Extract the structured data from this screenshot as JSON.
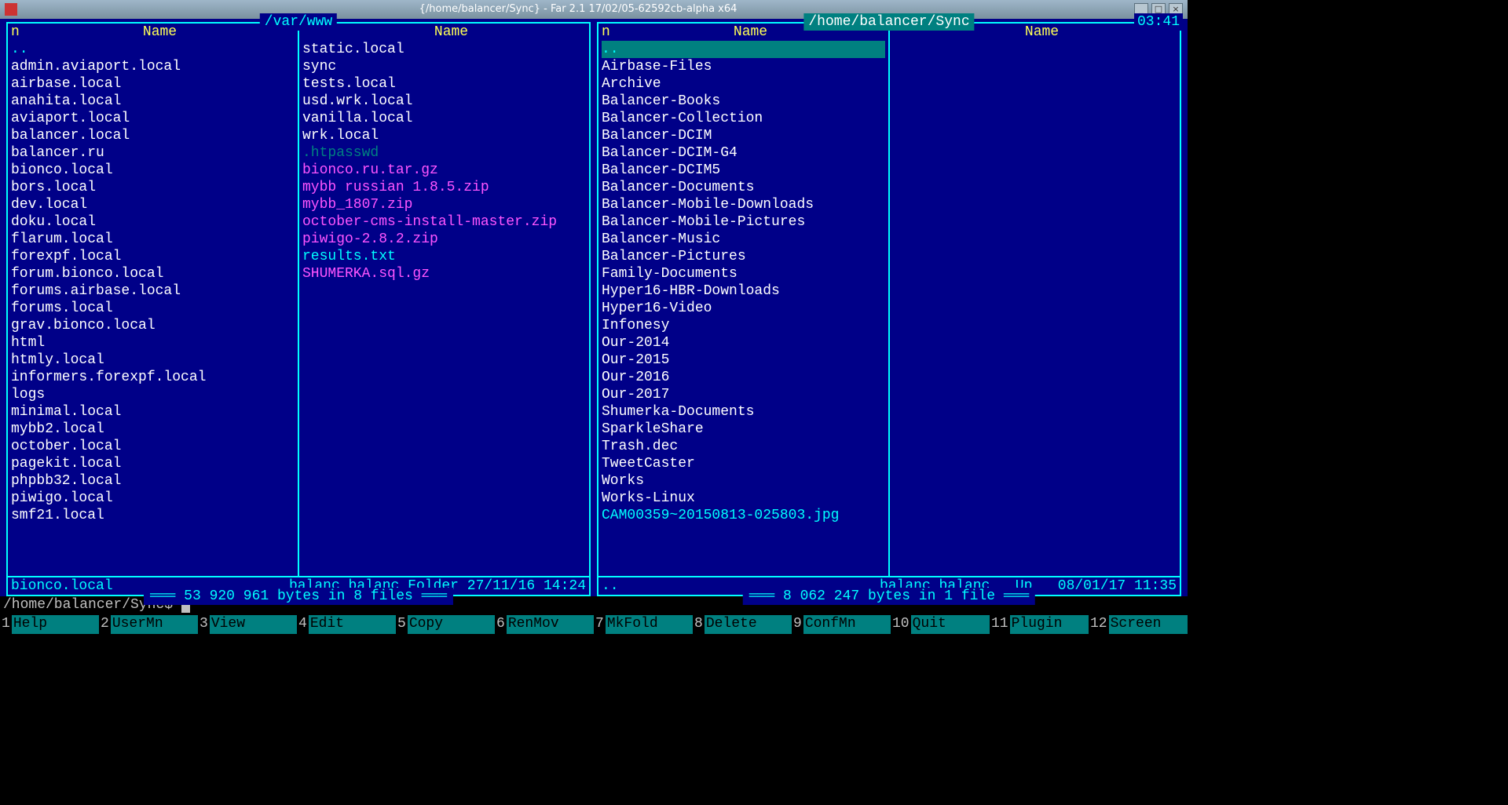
{
  "titlebar": {
    "title": "{/home/balancer/Sync} - Far 2.1 17/02/05-62592cb-alpha x64"
  },
  "clock": "03:41",
  "left_panel": {
    "path": "/var/www",
    "col_headers": {
      "n": "n",
      "name": "Name"
    },
    "col1": [
      {
        "t": "..",
        "cls": "updir"
      },
      {
        "t": "admin.aviaport.local",
        "cls": "dir"
      },
      {
        "t": "airbase.local",
        "cls": "dir"
      },
      {
        "t": "anahita.local",
        "cls": "dir"
      },
      {
        "t": "aviaport.local",
        "cls": "dir"
      },
      {
        "t": "balancer.local",
        "cls": "dir"
      },
      {
        "t": "balancer.ru",
        "cls": "dir"
      },
      {
        "t": "bionco.local",
        "cls": "dir"
      },
      {
        "t": "bors.local",
        "cls": "dir"
      },
      {
        "t": "dev.local",
        "cls": "dir"
      },
      {
        "t": "doku.local",
        "cls": "dir"
      },
      {
        "t": "flarum.local",
        "cls": "dir"
      },
      {
        "t": "forexpf.local",
        "cls": "dir"
      },
      {
        "t": "forum.bionco.local",
        "cls": "dir"
      },
      {
        "t": "forums.airbase.local",
        "cls": "dir"
      },
      {
        "t": "forums.local",
        "cls": "dir"
      },
      {
        "t": "grav.bionco.local",
        "cls": "dir"
      },
      {
        "t": "html",
        "cls": "dir"
      },
      {
        "t": "htmly.local",
        "cls": "dir"
      },
      {
        "t": "informers.forexpf.local",
        "cls": "dir"
      },
      {
        "t": "logs",
        "cls": "dir"
      },
      {
        "t": "minimal.local",
        "cls": "dir"
      },
      {
        "t": "mybb2.local",
        "cls": "dir"
      },
      {
        "t": "october.local",
        "cls": "dir"
      },
      {
        "t": "pagekit.local",
        "cls": "dir"
      },
      {
        "t": "phpbb32.local",
        "cls": "dir"
      },
      {
        "t": "piwigo.local",
        "cls": "dir"
      },
      {
        "t": "smf21.local",
        "cls": "dir"
      }
    ],
    "col2": [
      {
        "t": "static.local",
        "cls": "dir"
      },
      {
        "t": "sync",
        "cls": "dir"
      },
      {
        "t": "tests.local",
        "cls": "dir"
      },
      {
        "t": "usd.wrk.local",
        "cls": "dir"
      },
      {
        "t": "vanilla.local",
        "cls": "dir"
      },
      {
        "t": "wrk.local",
        "cls": "dir"
      },
      {
        "t": ".htpasswd",
        "cls": "hidden"
      },
      {
        "t": "bionco.ru.tar.gz",
        "cls": "archive"
      },
      {
        "t": "mybb russian 1.8.5.zip",
        "cls": "archive"
      },
      {
        "t": "mybb_1807.zip",
        "cls": "archive"
      },
      {
        "t": "october-cms-install-master.zip",
        "cls": "archive"
      },
      {
        "t": "piwigo-2.8.2.zip",
        "cls": "archive"
      },
      {
        "t": "results.txt",
        "cls": "text"
      },
      {
        "t": "SHUMERKA.sql.gz",
        "cls": "archive"
      }
    ],
    "status_sel": "bionco.local",
    "status_rest": "balanc balanc Folder 27/11/16 14:24",
    "summary": "53 920 961 bytes in 8 files"
  },
  "right_panel": {
    "path": "/home/balancer/Sync",
    "col_headers": {
      "n": "n",
      "name": "Name"
    },
    "col1": [
      {
        "t": "..",
        "cls": "updir selected"
      },
      {
        "t": "Airbase-Files",
        "cls": "dir"
      },
      {
        "t": "Archive",
        "cls": "dir"
      },
      {
        "t": "Balancer-Books",
        "cls": "dir"
      },
      {
        "t": "Balancer-Collection",
        "cls": "dir"
      },
      {
        "t": "Balancer-DCIM",
        "cls": "dir"
      },
      {
        "t": "Balancer-DCIM-G4",
        "cls": "dir"
      },
      {
        "t": "Balancer-DCIM5",
        "cls": "dir"
      },
      {
        "t": "Balancer-Documents",
        "cls": "dir"
      },
      {
        "t": "Balancer-Mobile-Downloads",
        "cls": "dir"
      },
      {
        "t": "Balancer-Mobile-Pictures",
        "cls": "dir"
      },
      {
        "t": "Balancer-Music",
        "cls": "dir"
      },
      {
        "t": "Balancer-Pictures",
        "cls": "dir"
      },
      {
        "t": "Family-Documents",
        "cls": "dir"
      },
      {
        "t": "Hyper16-HBR-Downloads",
        "cls": "dir"
      },
      {
        "t": "Hyper16-Video",
        "cls": "dir"
      },
      {
        "t": "Infonesy",
        "cls": "dir"
      },
      {
        "t": "Our-2014",
        "cls": "dir"
      },
      {
        "t": "Our-2015",
        "cls": "dir"
      },
      {
        "t": "Our-2016",
        "cls": "dir"
      },
      {
        "t": "Our-2017",
        "cls": "dir"
      },
      {
        "t": "Shumerka-Documents",
        "cls": "dir"
      },
      {
        "t": "SparkleShare",
        "cls": "dir"
      },
      {
        "t": "Trash.dec",
        "cls": "dir"
      },
      {
        "t": "TweetCaster",
        "cls": "dir"
      },
      {
        "t": "Works",
        "cls": "dir"
      },
      {
        "t": "Works-Linux",
        "cls": "dir"
      },
      {
        "t": "CAM00359~20150813-025803.jpg",
        "cls": "text"
      }
    ],
    "col2": [],
    "status_sel": "..",
    "status_rest": "balanc balanc   Up   08/01/17 11:35",
    "summary": "8 062 247 bytes in 1 file"
  },
  "cmdline": {
    "prompt": "/home/balancer/Sync$ "
  },
  "fkeys": [
    {
      "n": "1",
      "l": "Help"
    },
    {
      "n": "2",
      "l": "UserMn"
    },
    {
      "n": "3",
      "l": "View"
    },
    {
      "n": "4",
      "l": "Edit"
    },
    {
      "n": "5",
      "l": "Copy"
    },
    {
      "n": "6",
      "l": "RenMov"
    },
    {
      "n": "7",
      "l": "MkFold"
    },
    {
      "n": "8",
      "l": "Delete"
    },
    {
      "n": "9",
      "l": "ConfMn"
    },
    {
      "n": "10",
      "l": "Quit"
    },
    {
      "n": "11",
      "l": "Plugin"
    },
    {
      "n": "12",
      "l": "Screen"
    }
  ]
}
